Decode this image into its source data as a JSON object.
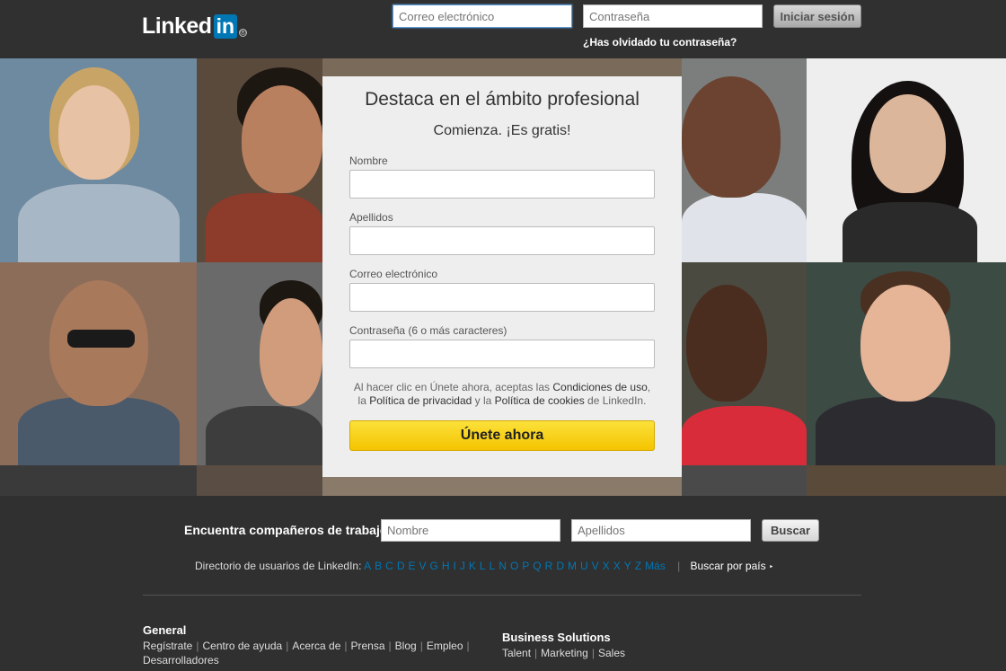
{
  "header": {
    "logo_text": "Linked",
    "logo_box": "in",
    "logo_reg": "®",
    "email_placeholder": "Correo electrónico",
    "password_placeholder": "Contraseña",
    "login_label": "Iniciar sesión",
    "forgot_label": "¿Has olvidado tu contraseña?"
  },
  "signup": {
    "title": "Destaca en el ámbito profesional",
    "subtitle": "Comienza. ¡Es gratis!",
    "first_name_label": "Nombre",
    "last_name_label": "Apellidos",
    "email_label": "Correo electrónico",
    "password_label": "Contraseña (6 o más caracteres)",
    "terms_prefix": "Al hacer clic en Únete ahora, aceptas las ",
    "terms_link": "Condiciones de uso",
    "terms_sep1": ",",
    "terms_line2_prefix": "la ",
    "privacy_link": "Política de privacidad",
    "terms_and": " y la ",
    "cookies_link": "Política de cookies",
    "terms_suffix": " de LinkedIn.",
    "join_label": "Únete ahora"
  },
  "search": {
    "label": "Encuentra compañeros de trabajo:",
    "first_placeholder": "Nombre",
    "last_placeholder": "Apellidos",
    "button_label": "Buscar"
  },
  "directory": {
    "label": "Directorio de usuarios de LinkedIn:",
    "letters": [
      "A",
      "B",
      "C",
      "D",
      "E",
      "V",
      "G",
      "H",
      "I",
      "J",
      "K",
      "L",
      "L",
      "N",
      "O",
      "P",
      "Q",
      "R",
      "D",
      "M",
      "U",
      "V",
      "X",
      "X",
      "Y",
      "Z",
      "Más"
    ],
    "country_label": "Buscar por país",
    "country_arrow": "‣"
  },
  "footer": {
    "general_title": "General",
    "general_links": [
      "Regístrate",
      "Centro de ayuda",
      "Acerca de",
      "Prensa",
      "Blog",
      "Empleo"
    ],
    "general_links2": [
      "Desarrolladores"
    ],
    "business_title": "Business Solutions",
    "business_links": [
      "Talent",
      "Marketing",
      "Sales"
    ]
  },
  "colors": {
    "background": "#303030",
    "brand_blue": "#0077b5",
    "join_yellow": "#f5c400"
  }
}
